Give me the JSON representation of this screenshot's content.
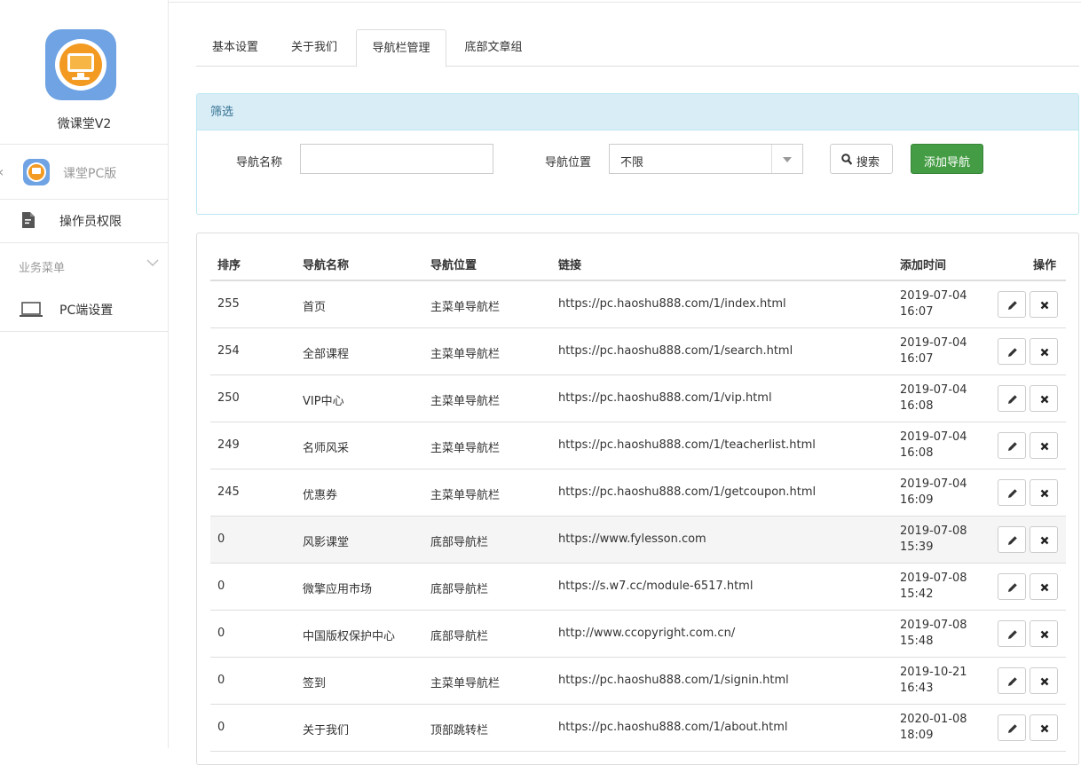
{
  "sidebar": {
    "app_name": "微课堂V2",
    "back_label": "课堂PC版",
    "operator_label": "操作员权限",
    "group_label": "业务菜单",
    "pc_settings_label": "PC端设置"
  },
  "tabs": [
    {
      "label": "基本设置"
    },
    {
      "label": "关于我们"
    },
    {
      "label": "导航栏管理",
      "active": true
    },
    {
      "label": "底部文章组"
    }
  ],
  "filter": {
    "title": "筛选",
    "name_label": "导航名称",
    "name_value": "",
    "position_label": "导航位置",
    "position_value": "不限",
    "search_label": "搜索",
    "add_label": "添加导航"
  },
  "table": {
    "headers": {
      "sort": "排序",
      "name": "导航名称",
      "position": "导航位置",
      "link": "链接",
      "time": "添加时间",
      "actions": "操作"
    },
    "rows": [
      {
        "sort": "255",
        "name": "首页",
        "position": "主菜单导航栏",
        "link": "https://pc.haoshu888.com/1/index.html",
        "date": "2019-07-04",
        "time": "16:07"
      },
      {
        "sort": "254",
        "name": "全部课程",
        "position": "主菜单导航栏",
        "link": "https://pc.haoshu888.com/1/search.html",
        "date": "2019-07-04",
        "time": "16:07"
      },
      {
        "sort": "250",
        "name": "VIP中心",
        "position": "主菜单导航栏",
        "link": "https://pc.haoshu888.com/1/vip.html",
        "date": "2019-07-04",
        "time": "16:08"
      },
      {
        "sort": "249",
        "name": "名师风采",
        "position": "主菜单导航栏",
        "link": "https://pc.haoshu888.com/1/teacherlist.html",
        "date": "2019-07-04",
        "time": "16:08"
      },
      {
        "sort": "245",
        "name": "优惠券",
        "position": "主菜单导航栏",
        "link": "https://pc.haoshu888.com/1/getcoupon.html",
        "date": "2019-07-04",
        "time": "16:09"
      },
      {
        "sort": "0",
        "name": "风影课堂",
        "position": "底部导航栏",
        "link": "https://www.fylesson.com",
        "date": "2019-07-08",
        "time": "15:39",
        "highlighted": true
      },
      {
        "sort": "0",
        "name": "微擎应用市场",
        "position": "底部导航栏",
        "link": "https://s.w7.cc/module-6517.html",
        "date": "2019-07-08",
        "time": "15:42"
      },
      {
        "sort": "0",
        "name": "中国版权保护中心",
        "position": "底部导航栏",
        "link": "http://www.ccopyright.com.cn/",
        "date": "2019-07-08",
        "time": "15:48"
      },
      {
        "sort": "0",
        "name": "签到",
        "position": "主菜单导航栏",
        "link": "https://pc.haoshu888.com/1/signin.html",
        "date": "2019-10-21",
        "time": "16:43"
      },
      {
        "sort": "0",
        "name": "关于我们",
        "position": "顶部跳转栏",
        "link": "https://pc.haoshu888.com/1/about.html",
        "date": "2020-01-08",
        "time": "18:09"
      }
    ]
  },
  "colors": {
    "accent_green": "#449d44",
    "panel_info_bg": "#d9edf7",
    "panel_info_text": "#31708f",
    "logo_blue": "#6fa3e3",
    "logo_orange": "#f39a22"
  },
  "icons": {
    "edit": "pencil-icon",
    "delete": "close-icon",
    "search": "search-icon"
  }
}
